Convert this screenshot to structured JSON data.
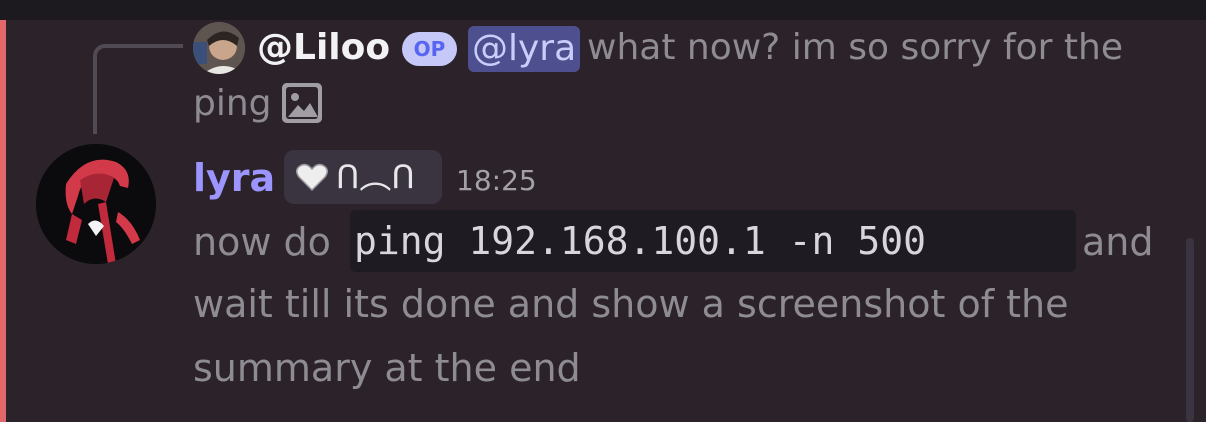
{
  "reply": {
    "username": "@Liloo",
    "badge": "OP",
    "mention": "@lyra",
    "text_line1": "what now? im so sorry for the",
    "text_line2": "ping",
    "attachment_icon": "image-icon"
  },
  "message": {
    "author": "lyra",
    "clan_tag": "ᑎ︵ᑎ",
    "timestamp": "18:25",
    "text_before_code": "now do",
    "code": "ping 192.168.100.1 -n 500",
    "text_after_code": "and",
    "line2": "wait till its done and show a screenshot of the",
    "line3": "summary at the end"
  },
  "colors": {
    "background": "#2b2329",
    "accent_bar": "#e2676a",
    "author_name": "#9c95ff",
    "mention_bg": "#4e4f8e",
    "op_badge_bg": "#c6c9f7"
  }
}
